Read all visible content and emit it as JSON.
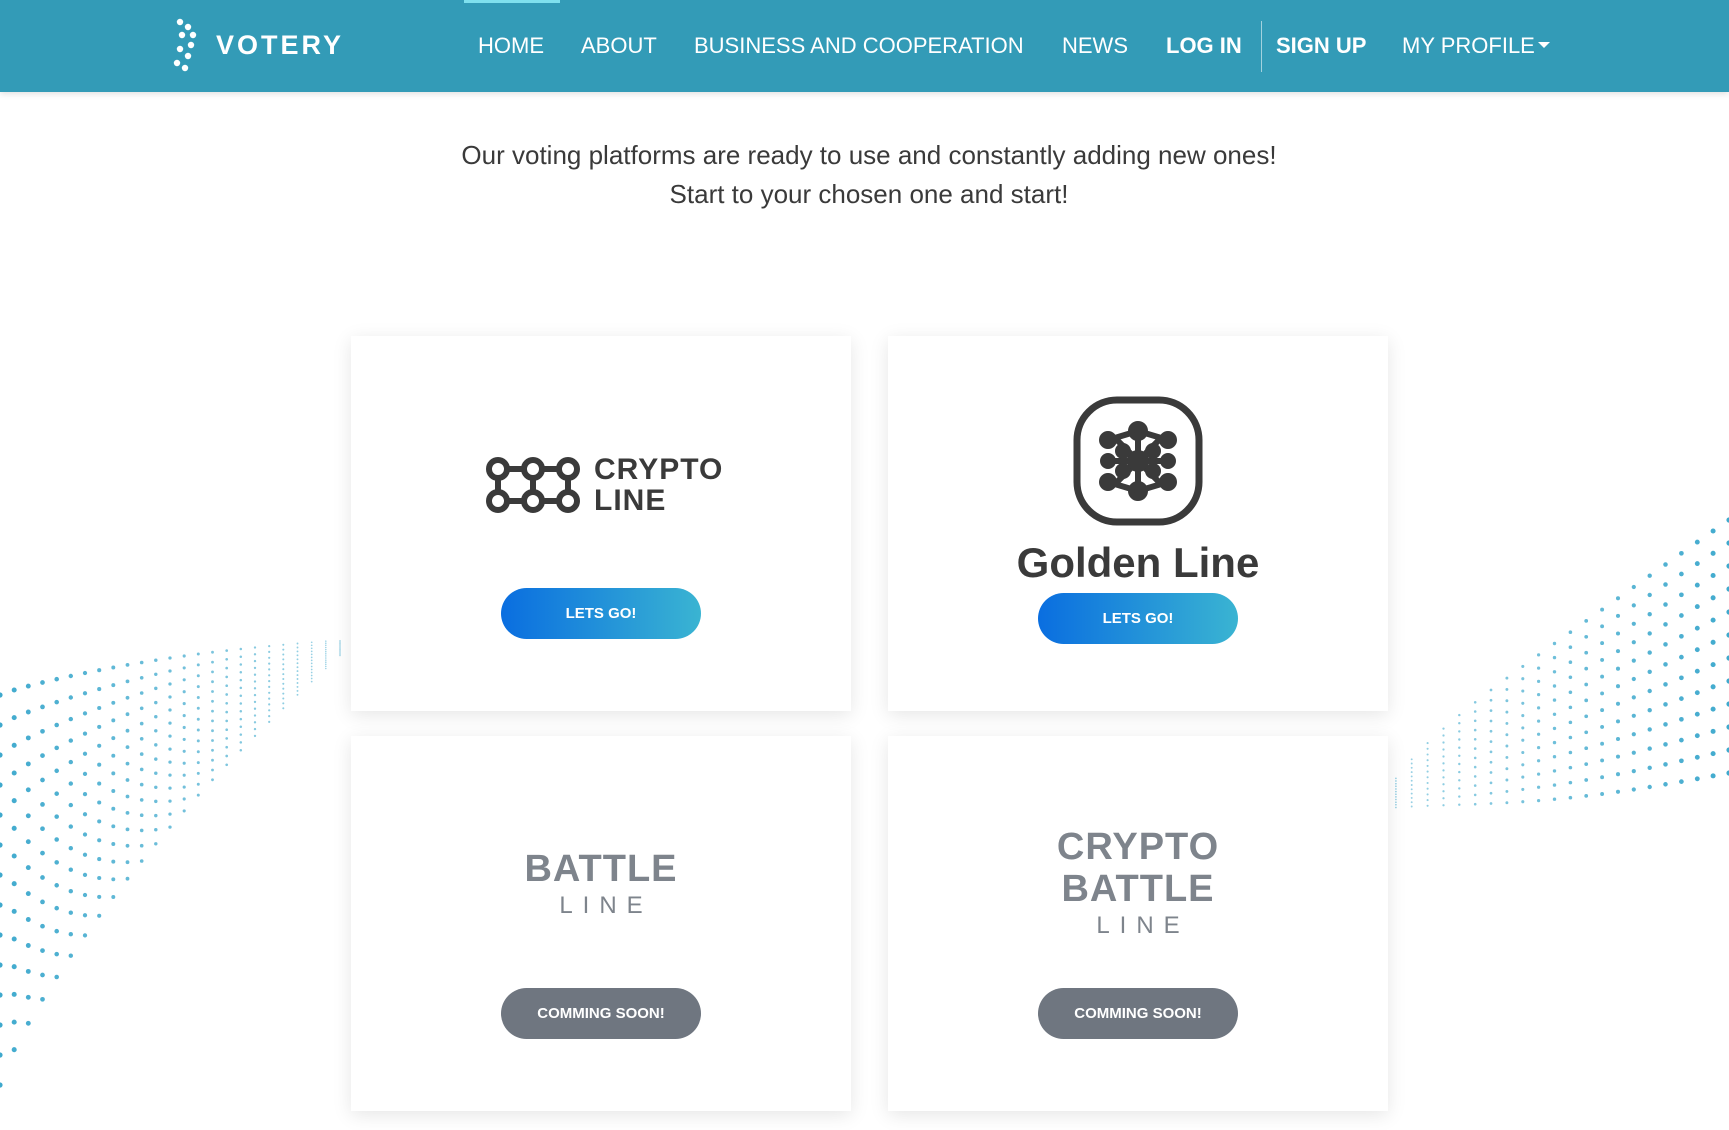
{
  "header": {
    "logo_text": "VOTERY",
    "nav": {
      "home": "HOME",
      "about": "ABOUT",
      "business": "BUSINESS AND COOPERATION",
      "news": "NEWS",
      "login": "LOG IN",
      "signup": "SIGN UP",
      "profile": "MY PROFILE"
    }
  },
  "intro": {
    "line1": "Our voting platforms are ready to use and constantly adding new ones!",
    "line2": "Start to your chosen one and start!"
  },
  "platforms": [
    {
      "name_line1": "CRYPTO",
      "name_line2": "LINE",
      "button": "LETS GO!",
      "status": "active"
    },
    {
      "name": "Golden Line",
      "button": "LETS GO!",
      "status": "active"
    },
    {
      "name_line1": "BATTLE",
      "name_line2": "LINE",
      "button": "COMMING SOON!",
      "status": "coming-soon"
    },
    {
      "name_line1": "CRYPTO",
      "name_line2": "BATTLE",
      "name_line3": "LINE",
      "button": "COMMING SOON!",
      "status": "coming-soon"
    }
  ],
  "colors": {
    "header_bg": "#339bb7",
    "button_gradient_start": "#0a6ee0",
    "button_gradient_end": "#3ab4d2",
    "button_disabled": "#6f7680",
    "wave_dots": "#2aa0c8"
  },
  "icons": {
    "logo": "votery-dots-icon",
    "crypto_line": "chain-links-icon",
    "golden_line": "molecule-icon",
    "profile_caret": "caret-down-icon"
  }
}
